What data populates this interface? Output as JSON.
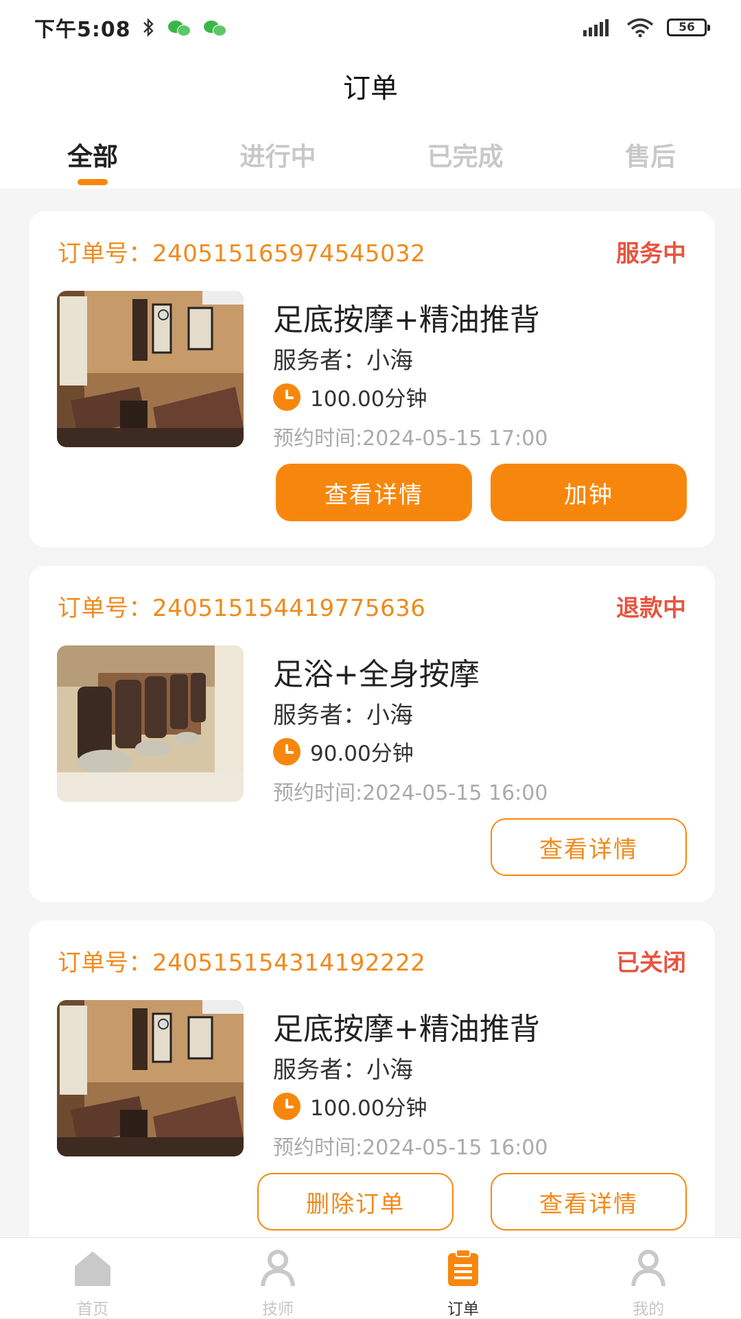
{
  "status_bar": {
    "time": "下午5:08",
    "battery": "56",
    "icons": [
      "bluetooth-icon",
      "wechat-icon",
      "wechat-icon",
      "signal-icon",
      "wifi-icon",
      "battery-icon"
    ]
  },
  "header": {
    "title": "订单"
  },
  "tabs": [
    {
      "label": "全部",
      "active": true
    },
    {
      "label": "进行中",
      "active": false
    },
    {
      "label": "已完成",
      "active": false
    },
    {
      "label": "售后",
      "active": false
    }
  ],
  "orders": [
    {
      "order_no": "订单号：240515165974545032",
      "status": "服务中",
      "service_name": "足底按摩+精油推背",
      "provider": "服务者：小海",
      "duration": "100.00分钟",
      "appointment": "预约时间:2024-05-15 17:00",
      "buttons": [
        "查看详情",
        "加钟"
      ]
    },
    {
      "order_no": "订单号：240515154419775636",
      "status": "退款中",
      "service_name": "足浴+全身按摩",
      "provider": "服务者：小海",
      "duration": "90.00分钟",
      "appointment": "预约时间:2024-05-15 16:00",
      "buttons": [
        "查看详情"
      ]
    },
    {
      "order_no": "订单号：240515154314192222",
      "status": "已关闭",
      "service_name": "足底按摩+精油推背",
      "provider": "服务者：小海",
      "duration": "100.00分钟",
      "appointment": "预约时间:2024-05-15 16:00",
      "buttons": [
        "删除订单",
        "查看详情"
      ]
    }
  ],
  "bottom_nav": [
    {
      "label": "首页",
      "icon": "home-icon",
      "active": false
    },
    {
      "label": "技师",
      "icon": "technician-icon",
      "active": false
    },
    {
      "label": "订单",
      "icon": "orders-icon",
      "active": true
    },
    {
      "label": "我的",
      "icon": "profile-icon",
      "active": false
    }
  ],
  "colors": {
    "accent": "#f7870c",
    "order_no": "#f08a1c",
    "status_red": "#e8543f",
    "muted": "#aaaaaa"
  }
}
